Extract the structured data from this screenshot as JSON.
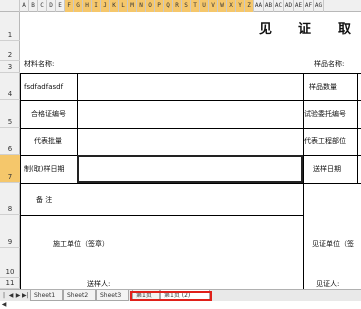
{
  "column_headers": [
    "A",
    "B",
    "C",
    "D",
    "E",
    "F",
    "G",
    "H",
    "I",
    "J",
    "K",
    "L",
    "M",
    "N",
    "O",
    "P",
    "Q",
    "R",
    "S",
    "T",
    "U",
    "V",
    "W",
    "X",
    "Y",
    "Z",
    "AA",
    "AB",
    "AC",
    "AD",
    "AE",
    "AF",
    "AG"
  ],
  "row_numbers": [
    "1",
    "2",
    "3",
    "4",
    "5",
    "6",
    "7",
    "8",
    "9",
    "10",
    "11"
  ],
  "form": {
    "title_part1": "见",
    "title_part2": "证",
    "title_part3": "取",
    "material_name_label": "材料名称:",
    "sample_name_label": "样品名称:",
    "row4_left": "fsdfadfasdf",
    "row4_right": "样品数量",
    "row5_left": "合格证编号",
    "row5_right": "试验委托编号",
    "row6_left": "代表批量",
    "row6_right": "代表工程部位",
    "row7_left": "制(取)样日期",
    "row7_right": "送样日期",
    "row8_left": "备  注",
    "row9_left": "施工单位（签章）",
    "row9_right": "见证单位（签",
    "row11_left": "送样人:",
    "row11_right": "见证人:"
  },
  "sheet_tabs": [
    "Sheet1",
    "Sheet2",
    "Sheet3",
    "第1页",
    "第1页 (2)"
  ],
  "active_tab": "第1页 (2)",
  "nav_buttons": [
    "|◀",
    "◀",
    "▶",
    "▶|"
  ],
  "highlight_color": "#e0201a",
  "selected_header_color": "#f5c76b"
}
